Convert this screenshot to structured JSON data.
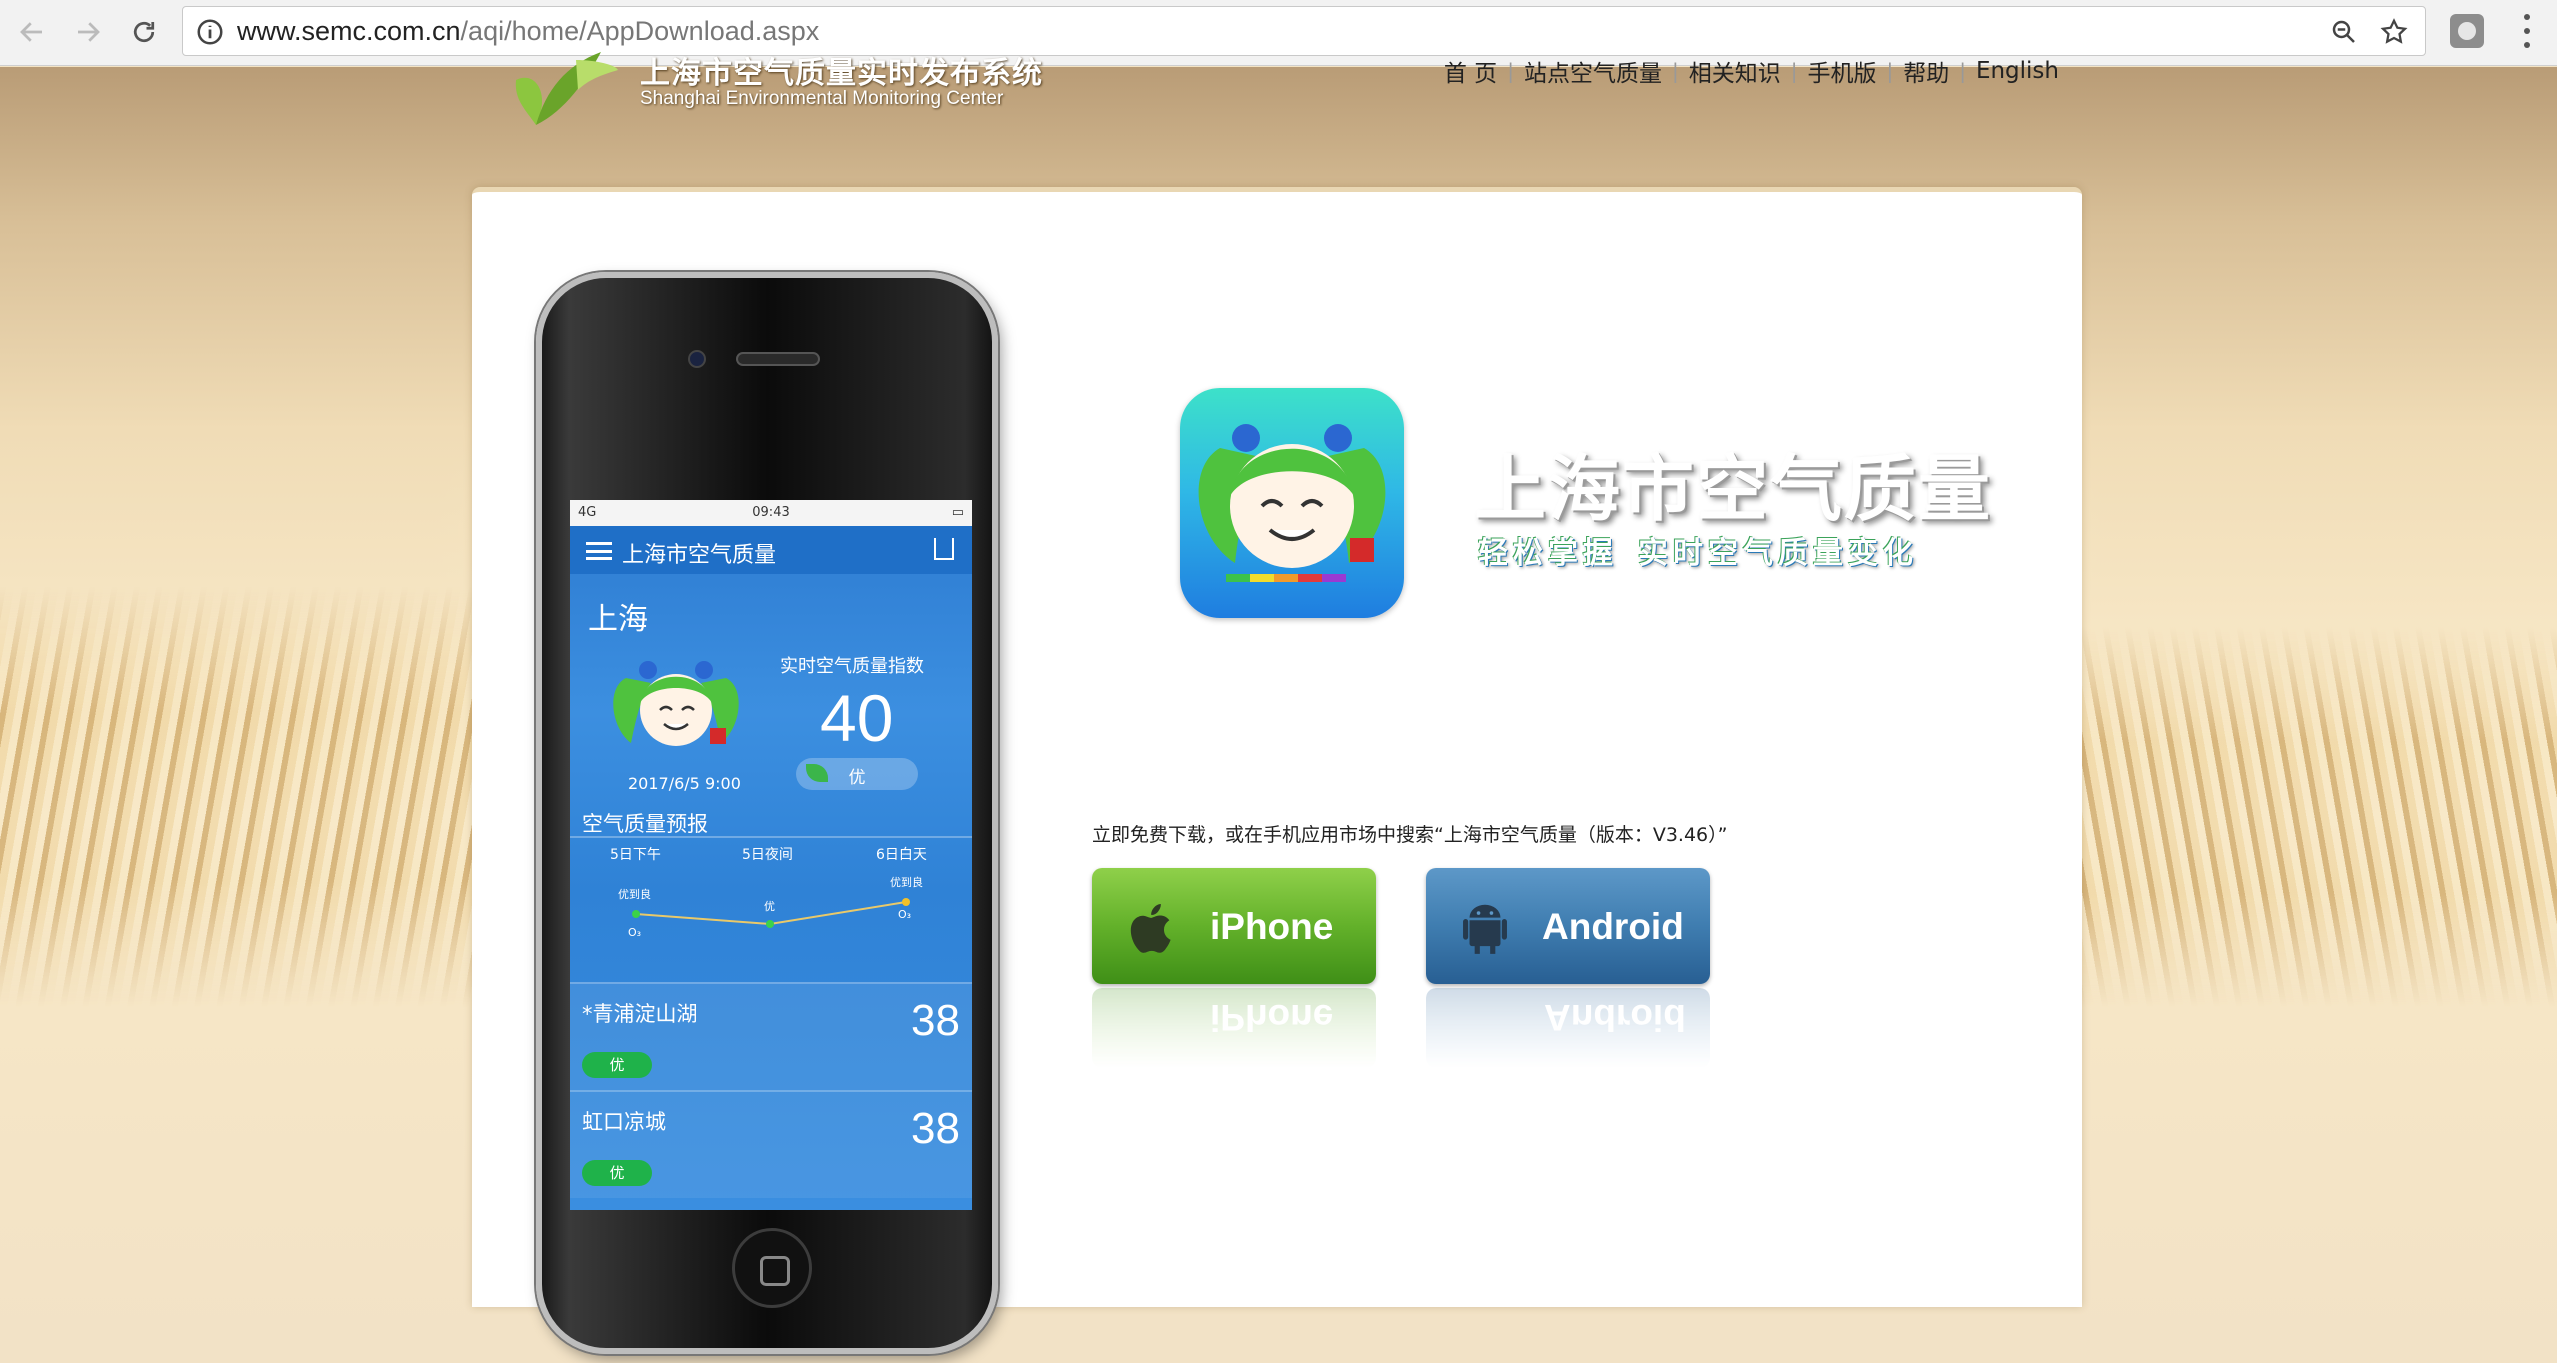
{
  "browser": {
    "url_host": "www.semc.com.cn",
    "url_path": "/aqi/home/AppDownload.aspx"
  },
  "header": {
    "title_cn": "上海市空气质量实时发布系统",
    "title_en": "Shanghai Environmental Monitoring Center",
    "nav": [
      "首 页",
      "站点空气质量",
      "相关知识",
      "手机版",
      "帮助",
      "English"
    ]
  },
  "phone_app": {
    "status_left": "4G",
    "status_time": "09:43",
    "appbar_title": "上海市空气质量",
    "city": "上海",
    "aqi_label": "实时空气质量指数",
    "aqi_value": "40",
    "aqi_level": "优",
    "timestamp": "2017/6/5 9:00",
    "forecast_title": "空气质量预报",
    "forecast": [
      {
        "period": "5日下午",
        "level": "优到良",
        "pollutant": "O₃"
      },
      {
        "period": "5日夜间",
        "level": "优",
        "pollutant": ""
      },
      {
        "period": "6日白天",
        "level": "优到良",
        "pollutant": "O₃"
      }
    ],
    "stations": [
      {
        "name": "*青浦淀山湖",
        "value": "38",
        "level": "优"
      },
      {
        "name": "虹口凉城",
        "value": "38",
        "level": "优"
      }
    ]
  },
  "promo": {
    "app_name": "上海市空气质量",
    "slogan_a": "轻松掌握",
    "slogan_b": "实时空气质量变化",
    "download_text": "立即免费下载，或在手机应用市场中搜索“上海市空气质量（版本：V3.46）”"
  },
  "buttons": {
    "iphone": "iPhone",
    "android": "Android"
  }
}
